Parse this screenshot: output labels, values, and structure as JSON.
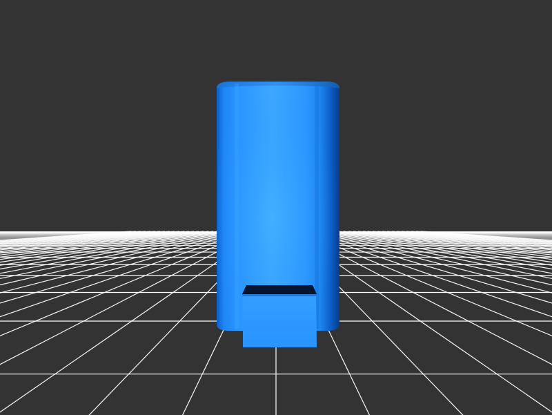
{
  "viewport": {
    "background_color": "#333333"
  },
  "grid": {
    "line_color": "#ffffff"
  },
  "model": {
    "shape": "rounded vertical cylinder with front rectangular block",
    "body_color": "#1e90ff",
    "highlight_color": "#41aaff",
    "shadow_color": "#0f5fc0",
    "slot_color": "#05152d"
  }
}
